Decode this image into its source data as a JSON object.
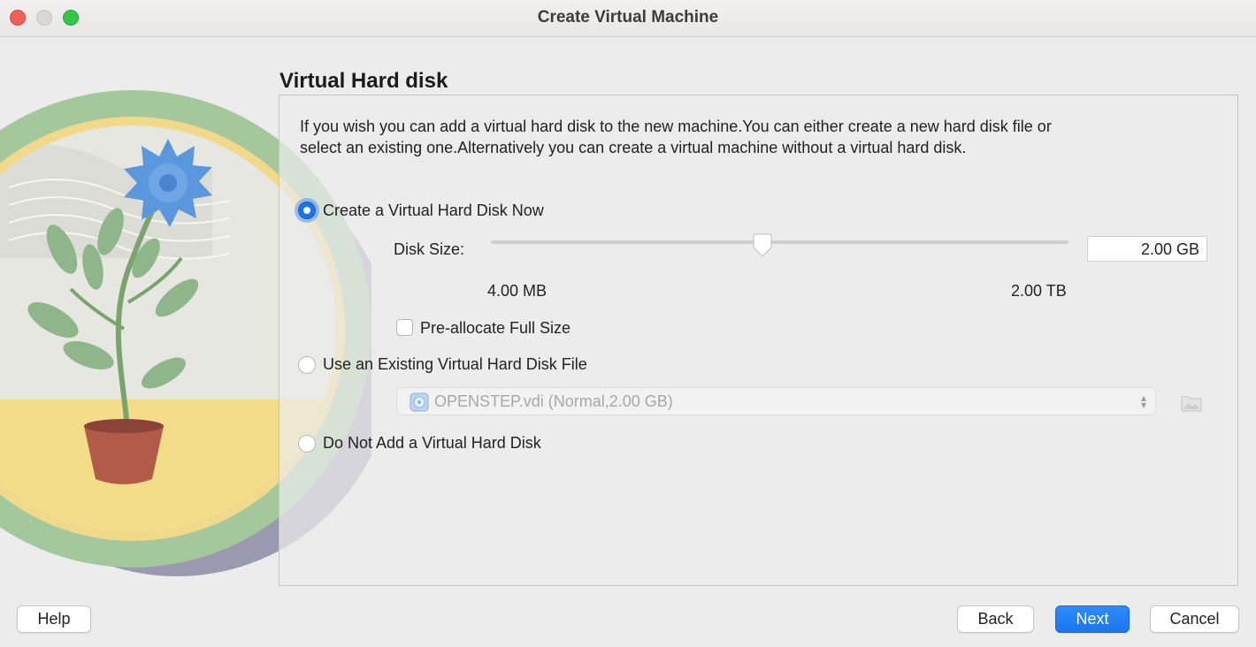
{
  "window": {
    "title": "Create Virtual Machine"
  },
  "page": {
    "heading": "Virtual Hard disk",
    "description": "If you wish you can add a virtual hard disk to the new machine.You can either create a new hard disk file or select an existing one.Alternatively you can create a virtual machine without a virtual hard disk."
  },
  "options": {
    "create_now": {
      "label": "Create a Virtual Hard Disk Now",
      "selected": true
    },
    "use_existing": {
      "label": "Use an Existing Virtual Hard Disk File",
      "selected": false
    },
    "no_disk": {
      "label": "Do Not Add a Virtual Hard Disk",
      "selected": false
    }
  },
  "disk_size": {
    "label": "Disk Size:",
    "value": "2.00 GB",
    "min_label": "4.00 MB",
    "max_label": "2.00 TB",
    "slider_fraction": 0.47
  },
  "preallocate": {
    "label": "Pre-allocate Full Size",
    "checked": false
  },
  "existing_disk": {
    "selected": "OPENSTEP.vdi (Normal,2.00 GB)",
    "enabled": false
  },
  "buttons": {
    "help": "Help",
    "back": "Back",
    "next": "Next",
    "cancel": "Cancel"
  },
  "colors": {
    "accent": "#1a73e8",
    "primary_button": "#1f7cf5"
  }
}
